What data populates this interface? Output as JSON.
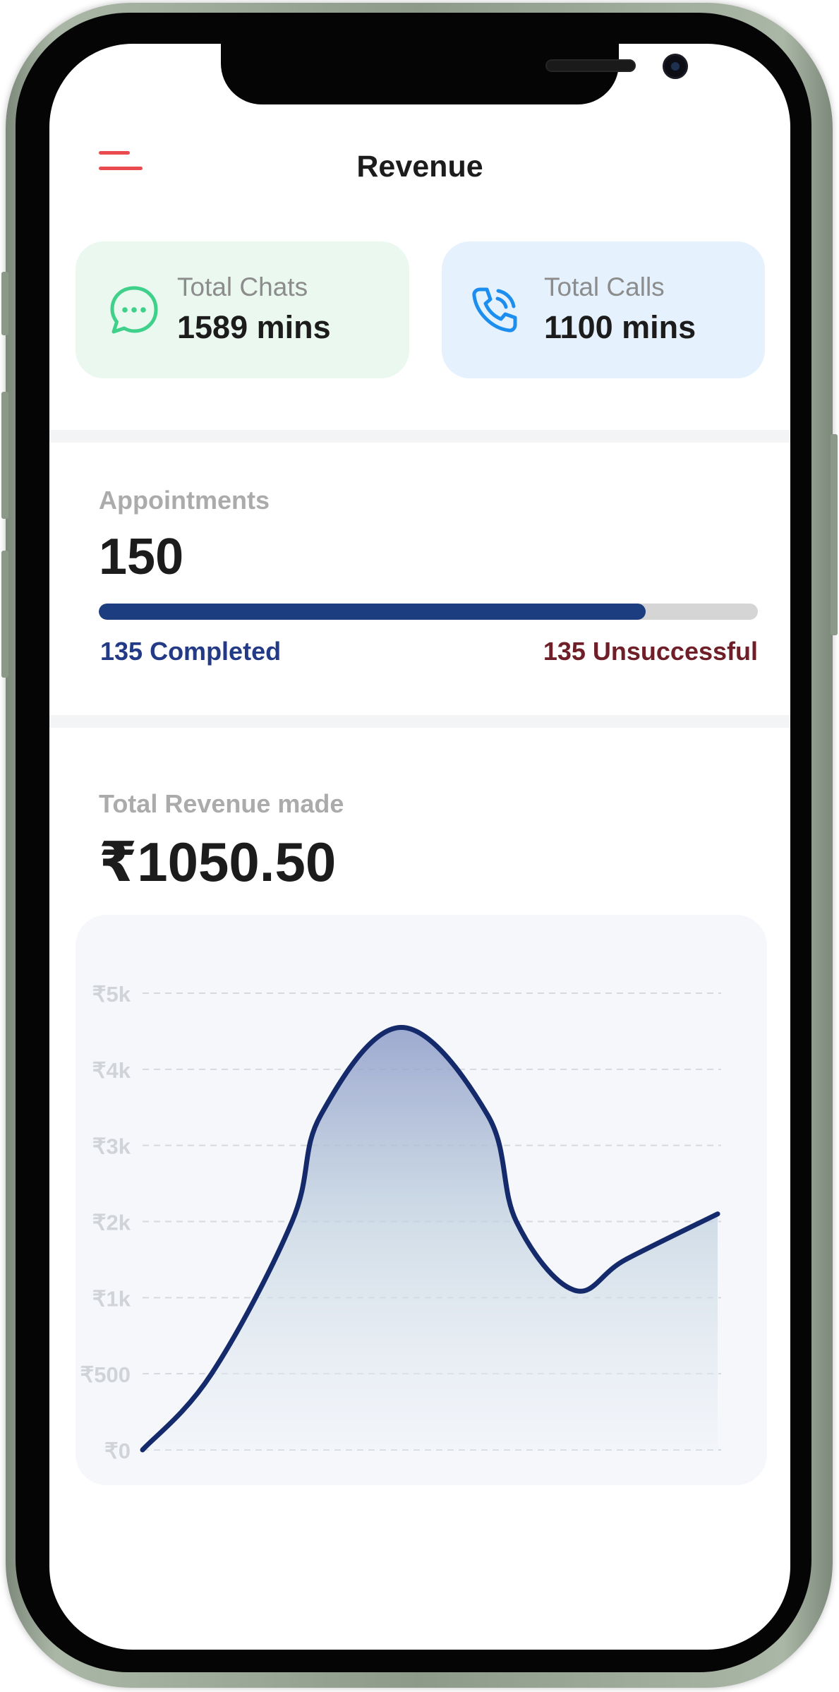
{
  "header": {
    "title": "Revenue",
    "menu_icon": "menu-icon",
    "menu_color": "#e94b4f"
  },
  "stats": {
    "chats": {
      "label": "Total Chats",
      "value": "1589 mins",
      "icon": "chat-bubble-icon",
      "color": "#3fd08a",
      "bg": "#eaf8f0"
    },
    "calls": {
      "label": "Total Calls",
      "value": "1100 mins",
      "icon": "phone-icon",
      "color": "#1c8ef0",
      "bg": "#e5f1fd"
    }
  },
  "appointments": {
    "label": "Appointments",
    "count": "150",
    "completed_label": "135 Completed",
    "unsuccessful_label": "135 Unsuccessful",
    "progress_fraction": 0.83,
    "colors": {
      "completed": "#233a86",
      "unsuccessful": "#6e1f28",
      "bar": "#1c3d80",
      "track": "#d5d5d5"
    }
  },
  "revenue": {
    "label": "Total Revenue made",
    "value": "₹1050.50"
  },
  "chart_data": {
    "type": "area",
    "title": "",
    "xlabel": "",
    "ylabel": "",
    "y_ticks": [
      {
        "label": "₹0",
        "value": 0
      },
      {
        "label": "₹500",
        "value": 500
      },
      {
        "label": "₹1k",
        "value": 1000
      },
      {
        "label": "₹2k",
        "value": 2000
      },
      {
        "label": "₹3k",
        "value": 3000
      },
      {
        "label": "₹4k",
        "value": 4000
      },
      {
        "label": "₹5k",
        "value": 5000
      }
    ],
    "y_scale": "categorical-ticks (evenly spaced labels)",
    "grid": "dashed horizontal",
    "legend": "none",
    "series": [
      {
        "values": [
          {
            "x": 0.0,
            "y": 0
          },
          {
            "x": 0.12,
            "y": 500
          },
          {
            "x": 0.26,
            "y": 2000
          },
          {
            "x": 0.31,
            "y": 3400
          },
          {
            "x": 0.45,
            "y": 4550
          },
          {
            "x": 0.6,
            "y": 3400
          },
          {
            "x": 0.65,
            "y": 2000
          },
          {
            "x": 0.75,
            "y": 1100
          },
          {
            "x": 0.84,
            "y": 1500
          },
          {
            "x": 1.0,
            "y": 2100
          }
        ],
        "color": "#142a6b"
      }
    ]
  }
}
